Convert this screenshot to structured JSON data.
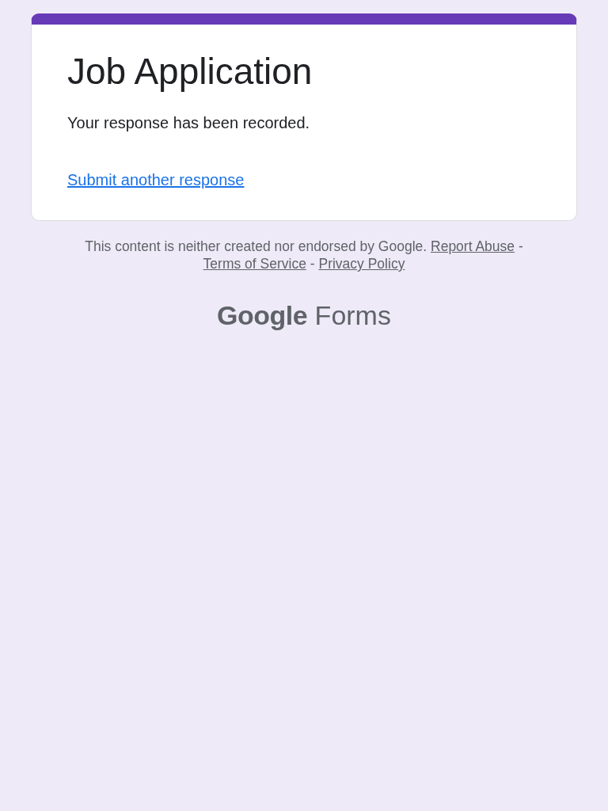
{
  "form": {
    "title": "Job Application",
    "message": "Your response has been recorded.",
    "link": "Submit another response"
  },
  "footer": {
    "disclaimer": "This content is neither created nor endorsed by Google.",
    "links": [
      {
        "label": "Report Abuse"
      },
      {
        "label": "Terms of Service"
      },
      {
        "label": "Privacy Policy"
      }
    ],
    "separators": [
      "-",
      "-"
    ]
  },
  "brand": {
    "logo": "Google",
    "product": "Forms"
  }
}
